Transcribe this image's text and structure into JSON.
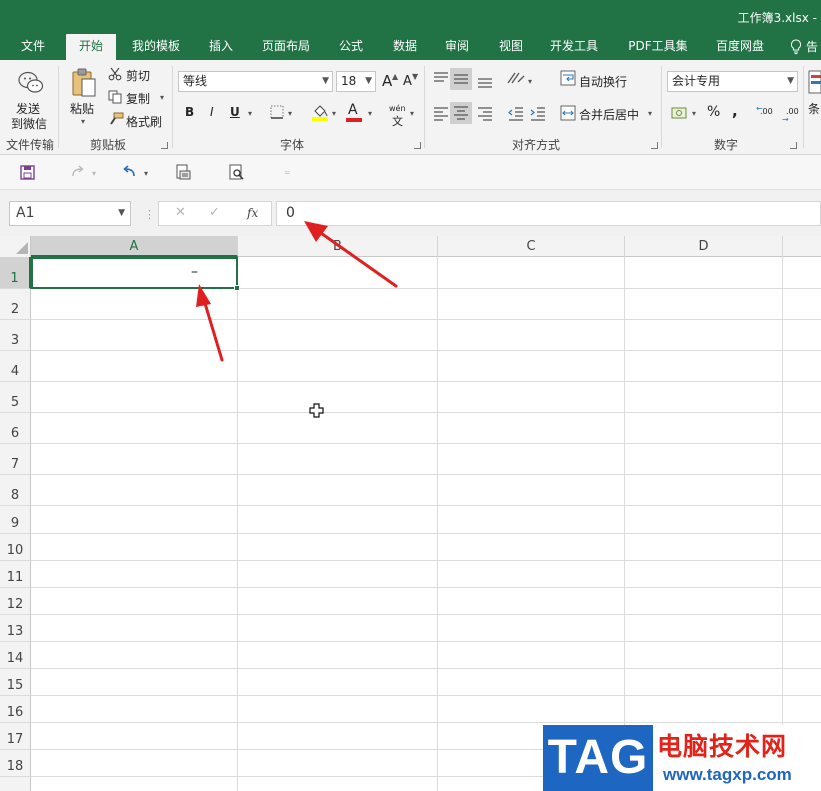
{
  "window": {
    "title": "工作簿3.xlsx -"
  },
  "tabs": [
    {
      "label": "文件",
      "active": false
    },
    {
      "label": "开始",
      "active": true
    },
    {
      "label": "我的模板",
      "active": false
    },
    {
      "label": "插入",
      "active": false
    },
    {
      "label": "页面布局",
      "active": false
    },
    {
      "label": "公式",
      "active": false
    },
    {
      "label": "数据",
      "active": false
    },
    {
      "label": "审阅",
      "active": false
    },
    {
      "label": "视图",
      "active": false
    },
    {
      "label": "开发工具",
      "active": false
    },
    {
      "label": "PDF工具集",
      "active": false
    },
    {
      "label": "百度网盘",
      "active": false
    }
  ],
  "tell_me": {
    "icon": "lightbulb-icon",
    "label": "告"
  },
  "ribbon": {
    "file_transfer": {
      "send_label": "发送",
      "wechat_label": "到微信",
      "group_label": "文件传输"
    },
    "clipboard": {
      "paste_label": "粘贴",
      "cut_label": "剪切",
      "copy_label": "复制",
      "format_painter_label": "格式刷",
      "group_label": "剪贴板"
    },
    "font": {
      "font_name": "等线",
      "font_size": "18",
      "grow_label": "A",
      "shrink_label": "A",
      "bold_label": "B",
      "italic_label": "I",
      "underline_label": "U",
      "font_color_label": "A",
      "phonetic_label": "wén",
      "phonetic_char": "文",
      "group_label": "字体"
    },
    "alignment": {
      "wrap_label": "自动换行",
      "merge_label": "合并后居中",
      "group_label": "对齐方式"
    },
    "number": {
      "format": "会计专用",
      "percent_label": "%",
      "comma_label": ",",
      "increase_decimal_label": ".00",
      "decrease_decimal_label": ".00",
      "group_label": "数字"
    },
    "styles": {
      "conditional_label": "条"
    }
  },
  "formula_bar": {
    "name_box": "A1",
    "cancel_icon": "✕",
    "enter_icon": "✓",
    "fx_label": "fx",
    "value": "0"
  },
  "sheet": {
    "columns": [
      "A",
      "B",
      "C",
      "D"
    ],
    "rows": [
      "1",
      "2",
      "3",
      "4",
      "5",
      "6",
      "7",
      "8",
      "9",
      "10",
      "11",
      "12",
      "13",
      "14",
      "15",
      "16",
      "17",
      "18"
    ],
    "selected_cell": "A1",
    "a1_display": "–"
  },
  "watermark": {
    "tag": "TAG",
    "name": "电脑技术网",
    "url": "www.tagxp.com"
  },
  "colors": {
    "accent": "#217346",
    "annotation_arrow": "#e02020",
    "watermark_blue": "#1d66c2",
    "watermark_red": "#e2231a"
  }
}
